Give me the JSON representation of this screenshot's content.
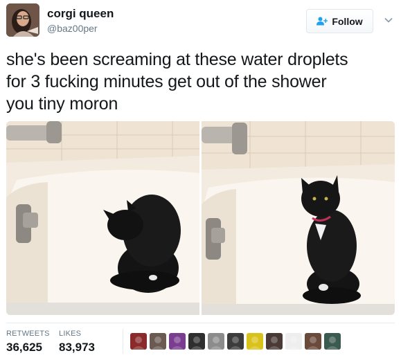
{
  "user": {
    "display_name": "corgi queen",
    "handle": "@baz00per"
  },
  "follow_button": {
    "label": "Follow",
    "icon": "add-user-icon"
  },
  "tweet": {
    "lines": [
      "she's been screaming at these water droplets",
      "for 3 fucking minutes get out of the shower",
      "you tiny moron"
    ]
  },
  "media": {
    "photos": [
      {
        "subject": "black cat sitting in bathtub looking down"
      },
      {
        "subject": "black cat in bathtub looking forward"
      }
    ]
  },
  "stats": {
    "retweets_label": "RETWEETS",
    "retweets_value": "36,625",
    "likes_label": "LIKES",
    "likes_value": "83,973"
  },
  "likers": {
    "colors": [
      "#8a2a2a",
      "#6b5a52",
      "#7a3d8f",
      "#2f2f2f",
      "#8c8c8c",
      "#3c3c3c",
      "#d9c21a",
      "#4a3a35",
      "#eeeeee",
      "#6a4a3a",
      "#3b5a50"
    ]
  },
  "colors": {
    "text": "#14171a",
    "muted": "#657786",
    "divider": "#e6ecf0",
    "follow_icon": "#1da1f2"
  }
}
